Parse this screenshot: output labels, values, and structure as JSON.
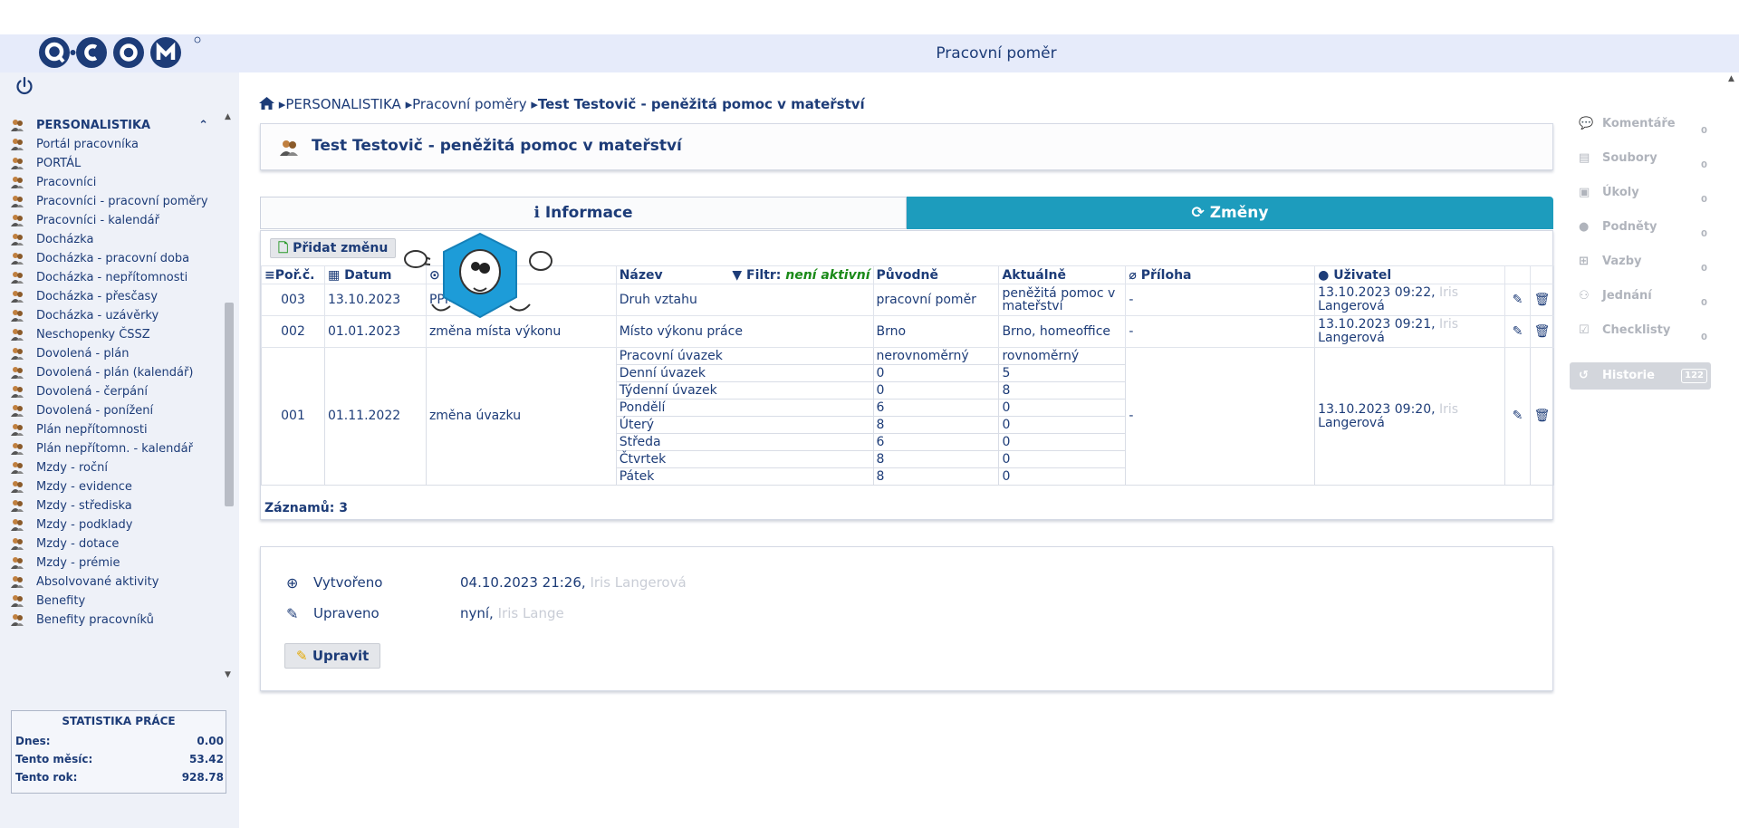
{
  "window": {
    "title": "Pracovní poměr"
  },
  "brand": {
    "accent": "#1d9cbd",
    "text": "#1d3c78",
    "green": "#1a8a18"
  },
  "sidebar": {
    "items": [
      {
        "label": "PERSONALISTIKA"
      },
      {
        "label": "Portál pracovníka"
      },
      {
        "label": "PORTÁL"
      },
      {
        "label": "Pracovníci"
      },
      {
        "label": "Pracovníci - pracovní poměry"
      },
      {
        "label": "Pracovníci - kalendář"
      },
      {
        "label": "Docházka"
      },
      {
        "label": "Docházka - pracovní doba"
      },
      {
        "label": "Docházka - nepřítomnosti"
      },
      {
        "label": "Docházka - přesčasy"
      },
      {
        "label": "Docházka - uzávěrky"
      },
      {
        "label": "Neschopenky ČSSZ"
      },
      {
        "label": "Dovolená - plán"
      },
      {
        "label": "Dovolená - plán (kalendář)"
      },
      {
        "label": "Dovolená - čerpání"
      },
      {
        "label": "Dovolená - ponížení"
      },
      {
        "label": "Plán nepřítomnosti"
      },
      {
        "label": "Plán nepřítomn. - kalendář"
      },
      {
        "label": "Mzdy - roční"
      },
      {
        "label": "Mzdy - evidence"
      },
      {
        "label": "Mzdy - střediska"
      },
      {
        "label": "Mzdy - podklady"
      },
      {
        "label": "Mzdy - dotace"
      },
      {
        "label": "Mzdy - prémie"
      },
      {
        "label": "Absolvované aktivity"
      },
      {
        "label": "Benefity"
      },
      {
        "label": "Benefity pracovníků"
      }
    ]
  },
  "stats": {
    "title": "STATISTIKA PRÁCE",
    "rows": [
      {
        "label": "Dnes:",
        "value": "0.00"
      },
      {
        "label": "Tento měsíc:",
        "value": "53.42"
      },
      {
        "label": "Tento rok:",
        "value": "928.78"
      }
    ]
  },
  "breadcrumb": {
    "root": "PERSONALISTIKA",
    "section": "Pracovní poměry",
    "current": "Test Testovič - peněžitá pomoc v mateřství"
  },
  "header": {
    "title": "Test Testovič - peněžitá pomoc v mateřství"
  },
  "tabs": [
    {
      "label": "Informace"
    },
    {
      "label": "Změny"
    }
  ],
  "toolbar": {
    "add_label": "Přidat změnu"
  },
  "table": {
    "headers": {
      "no": "Poř.č.",
      "date": "Datum",
      "name": "Název",
      "filter_label": "Filtr:",
      "filter_value": "není aktivní",
      "orig": "Původně",
      "curr": "Aktuálně",
      "attach": "Příloha",
      "user": "Uživatel"
    },
    "rows": [
      {
        "no": "003",
        "date": "13.10.2023",
        "type": "PPM",
        "name": "Druh vztahu",
        "orig": "pracovní poměr",
        "curr": "peněžitá pomoc v mateřství",
        "attach": "-",
        "user_time": "13.10.2023 09:22,",
        "user_first": "Iris",
        "user_last": "Langerová"
      },
      {
        "no": "002",
        "date": "01.01.2023",
        "type": "změna místa výkonu",
        "name": "Místo výkonu práce",
        "orig": "Brno",
        "curr": "Brno, homeoffice",
        "attach": "-",
        "user_time": "13.10.2023 09:21,",
        "user_first": "Iris",
        "user_last": "Langerová"
      }
    ],
    "group": {
      "no": "001",
      "date": "01.11.2022",
      "type": "změna úvazku",
      "attach": "-",
      "user_time": "13.10.2023 09:20,",
      "user_first": "Iris",
      "user_last": "Langerová",
      "lines": [
        {
          "name": "Pracovní úvazek",
          "orig": "nerovnoměrný",
          "curr": "rovnoměrný"
        },
        {
          "name": "Denní úvazek",
          "orig": "0",
          "curr": "5"
        },
        {
          "name": "Týdenní úvazek",
          "orig": "0",
          "curr": "8"
        },
        {
          "name": "Pondělí",
          "orig": "6",
          "curr": "0"
        },
        {
          "name": "Úterý",
          "orig": "8",
          "curr": "0"
        },
        {
          "name": "Středa",
          "orig": "6",
          "curr": "0"
        },
        {
          "name": "Čtvrtek",
          "orig": "8",
          "curr": "0"
        },
        {
          "name": "Pátek",
          "orig": "8",
          "curr": "0"
        }
      ]
    },
    "records_label": "Záznamů: 3"
  },
  "meta": {
    "created_label": "Vytvořeno",
    "created_value": "04.10.2023 21:26,",
    "created_user": "Iris Langerová",
    "updated_label": "Upraveno",
    "updated_value": "nyní,",
    "updated_user": "Iris Lange",
    "edit_label": "Upravit"
  },
  "right_panel": [
    {
      "label": "Komentáře",
      "count": "0",
      "icon": "comment-icon"
    },
    {
      "label": "Soubory",
      "count": "0",
      "icon": "file-icon"
    },
    {
      "label": "Úkoly",
      "count": "0",
      "icon": "clipboard-icon"
    },
    {
      "label": "Podněty",
      "count": "0",
      "icon": "lightbulb-icon"
    },
    {
      "label": "Vazby",
      "count": "0",
      "icon": "sitemap-icon"
    },
    {
      "label": "Jednání",
      "count": "0",
      "icon": "people-icon"
    },
    {
      "label": "Checklisty",
      "count": "0",
      "icon": "checkbox-icon"
    },
    {
      "label": "Historie",
      "count": "122",
      "icon": "history-icon"
    }
  ]
}
